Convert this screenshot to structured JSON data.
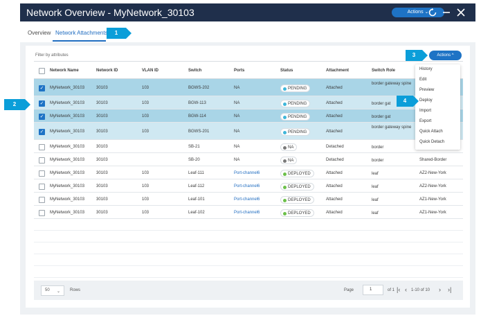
{
  "window": {
    "title": "Network Overview - MyNetwork_30103",
    "actions_label": "Actions ⌄",
    "refresh_icon": "refresh-icon",
    "minimize_icon": "minimize-icon",
    "close_icon": "close-icon"
  },
  "tabs": [
    {
      "label": "Overview",
      "active": false
    },
    {
      "label": "Network Attachments",
      "active": true
    }
  ],
  "filter": {
    "placeholder": "Filter by attributes"
  },
  "panel_actions_label": "Actions ^",
  "table": {
    "columns": [
      "Network Name",
      "Network ID",
      "VLAN ID",
      "Switch",
      "Ports",
      "Status",
      "Attachment",
      "Switch Role"
    ],
    "rows": [
      {
        "checked": true,
        "network_name": "MyNetwork_30103",
        "network_id": "30103",
        "vlan_id": "103",
        "switch": "BGWS-202",
        "ports": "NA",
        "status": "PENDING",
        "attachment": "Attached",
        "switch_role": "border gateway spine",
        "extra": ""
      },
      {
        "checked": true,
        "network_name": "MyNetwork_30103",
        "network_id": "30103",
        "vlan_id": "103",
        "switch": "BGW-113",
        "ports": "NA",
        "status": "PENDING",
        "attachment": "Attached",
        "switch_role": "border gat",
        "extra": ""
      },
      {
        "checked": true,
        "network_name": "MyNetwork_30103",
        "network_id": "30103",
        "vlan_id": "103",
        "switch": "BGW-114",
        "ports": "NA",
        "status": "PENDING",
        "attachment": "Attached",
        "switch_role": "border gat",
        "extra": ""
      },
      {
        "checked": true,
        "network_name": "MyNetwork_30103",
        "network_id": "30103",
        "vlan_id": "103",
        "switch": "BGWS-201",
        "ports": "NA",
        "status": "PENDING",
        "attachment": "Attached",
        "switch_role": "border gateway spine",
        "extra": ""
      },
      {
        "checked": false,
        "network_name": "MyNetwork_30103",
        "network_id": "30103",
        "vlan_id": "",
        "switch": "SB-21",
        "ports": "NA",
        "status": "NA",
        "attachment": "Detached",
        "switch_role": "border",
        "extra": ""
      },
      {
        "checked": false,
        "network_name": "MyNetwork_30103",
        "network_id": "30103",
        "vlan_id": "",
        "switch": "SB-20",
        "ports": "NA",
        "status": "NA",
        "attachment": "Detached",
        "switch_role": "border",
        "extra": "Shared-Border"
      },
      {
        "checked": false,
        "network_name": "MyNetwork_30103",
        "network_id": "30103",
        "vlan_id": "103",
        "switch": "Leaf-111",
        "ports": "Port-channel6",
        "status": "DEPLOYED",
        "attachment": "Attached",
        "switch_role": "leaf",
        "extra": "AZ2-New-York"
      },
      {
        "checked": false,
        "network_name": "MyNetwork_30103",
        "network_id": "30103",
        "vlan_id": "103",
        "switch": "Leaf-112",
        "ports": "Port-channel6",
        "status": "DEPLOYED",
        "attachment": "Attached",
        "switch_role": "leaf",
        "extra": "AZ2-New-York"
      },
      {
        "checked": false,
        "network_name": "MyNetwork_30103",
        "network_id": "30103",
        "vlan_id": "103",
        "switch": "Leaf-101",
        "ports": "Port-channel6",
        "status": "DEPLOYED",
        "attachment": "Attached",
        "switch_role": "leaf",
        "extra": "AZ1-New-York"
      },
      {
        "checked": false,
        "network_name": "MyNetwork_30103",
        "network_id": "30103",
        "vlan_id": "103",
        "switch": "Leaf-102",
        "ports": "Port-channel6",
        "status": "DEPLOYED",
        "attachment": "Attached",
        "switch_role": "leaf",
        "extra": "AZ1-New-York"
      }
    ]
  },
  "status_colors": {
    "PENDING": "#3fb6d9",
    "NA": "#7a7a7a",
    "DEPLOYED": "#6cc04a"
  },
  "dropdown": {
    "items": [
      "History",
      "Edit",
      "Preview",
      "Deploy",
      "Import",
      "Export",
      "Quick Attach",
      "Quick Detach"
    ]
  },
  "footer": {
    "rows_value": "50",
    "rows_label": "Rows",
    "page_label": "Page",
    "page_value": "1",
    "of_label": "of 1",
    "range_label": "1-10 of 10"
  },
  "callouts": [
    "1",
    "2",
    "3",
    "4"
  ]
}
